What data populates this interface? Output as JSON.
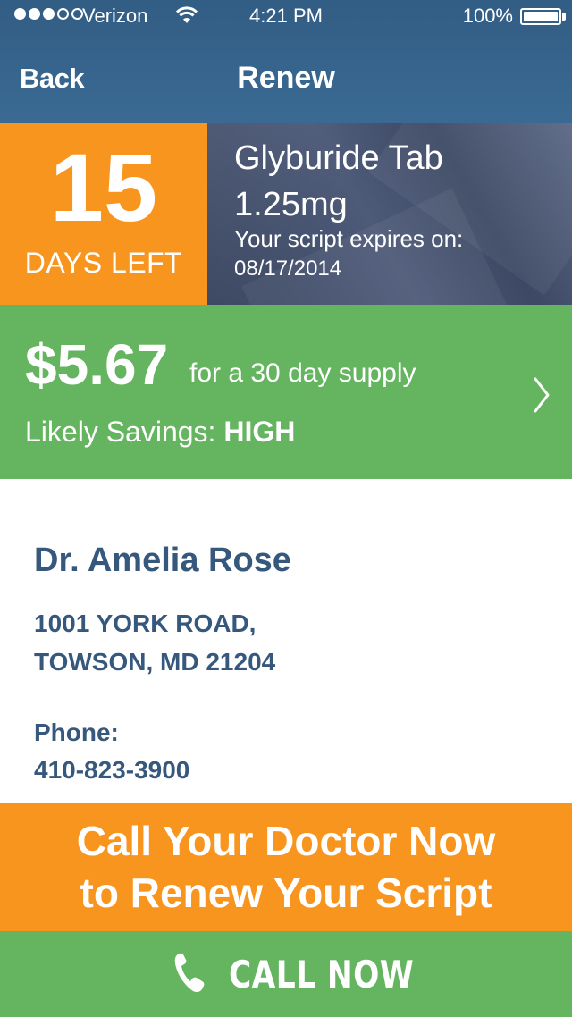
{
  "status_bar": {
    "carrier": "Verizon",
    "time": "4:21 PM",
    "battery": "100%",
    "battery_level": 1.0,
    "signal_bars_filled": 3,
    "signal_bars_total": 5
  },
  "nav": {
    "back_label": "Back",
    "title": "Renew"
  },
  "prescription": {
    "days_left": "15",
    "days_left_label": "DAYS LEFT",
    "drug_name": "Glyburide Tab",
    "dose": "1.25mg",
    "expires_label": "Your script expires on:",
    "expires_date": "08/17/2014"
  },
  "pricing": {
    "price": "$5.67",
    "supply_text": "for a 30 day supply",
    "savings_label": "Likely Savings:",
    "savings_value": "HIGH"
  },
  "doctor": {
    "name": "Dr. Amelia Rose",
    "address_line1": "1001 YORK ROAD,",
    "address_line2": "TOWSON, MD 21204",
    "phone_label": "Phone:",
    "phone": "410-823-3900"
  },
  "cta": {
    "line1": "Call Your Doctor Now",
    "line2": "to Renew Your Script",
    "button_label": "CALL NOW"
  },
  "colors": {
    "header": "#325d84",
    "orange": "#f7951e",
    "green": "#65b460",
    "doctor_text": "#36587c",
    "drug_panel": "#46526e"
  },
  "icons": {
    "wifi": "wifi-icon",
    "battery": "battery-icon",
    "chevron": "chevron-right-icon",
    "phone": "phone-icon"
  }
}
